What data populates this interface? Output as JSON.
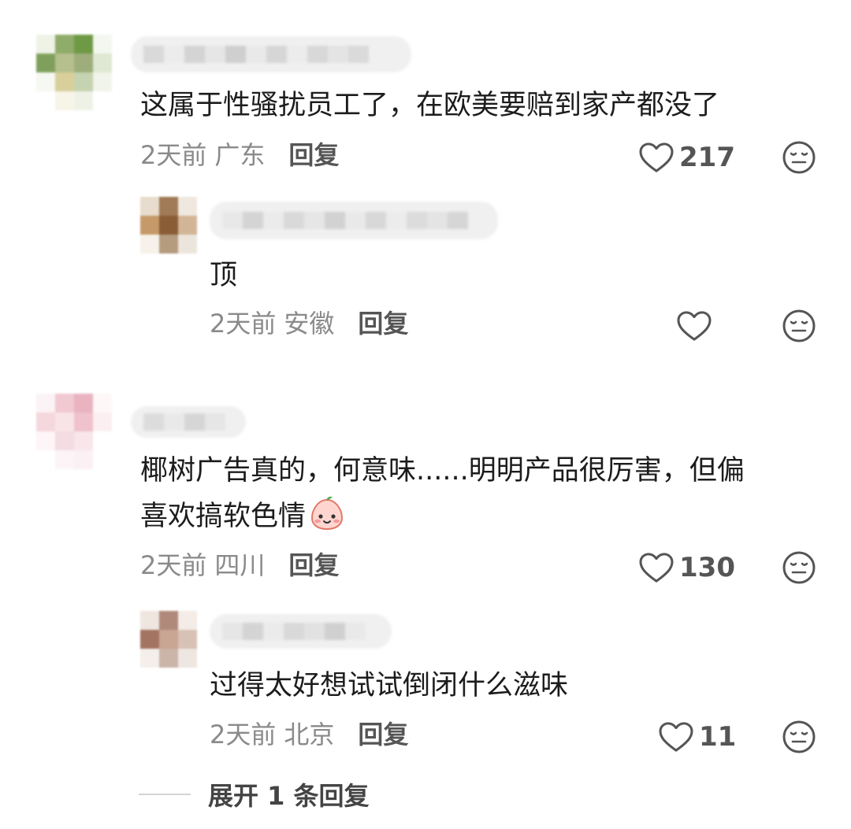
{
  "comments": [
    {
      "text": "这属于性骚扰员工了，在欧美要赔到家产都没了",
      "time": "2天前",
      "location": "广东",
      "reply_label": "回复",
      "likes": "217",
      "replies": [
        {
          "text": "顶",
          "time": "2天前",
          "location": "安徽",
          "reply_label": "回复",
          "likes": ""
        }
      ]
    },
    {
      "text_line1": "椰树广告真的，何意味......明明产品很厉害，但偏",
      "text_line2": "喜欢搞软色情",
      "time": "2天前",
      "location": "四川",
      "reply_label": "回复",
      "likes": "130",
      "replies": [
        {
          "text": "过得太好想试试倒闭什么滋味",
          "time": "2天前",
          "location": "北京",
          "reply_label": "回复",
          "likes": "11"
        }
      ],
      "expand_label": "展开 1 条回复"
    }
  ],
  "icons": {
    "like": "heart-outline-icon",
    "dislike": "meh-face-icon",
    "emoji": "smiling-face-emoji"
  },
  "colors": {
    "text": "#1c1c1c",
    "meta": "#8a8a8a",
    "icon": "#555555"
  }
}
